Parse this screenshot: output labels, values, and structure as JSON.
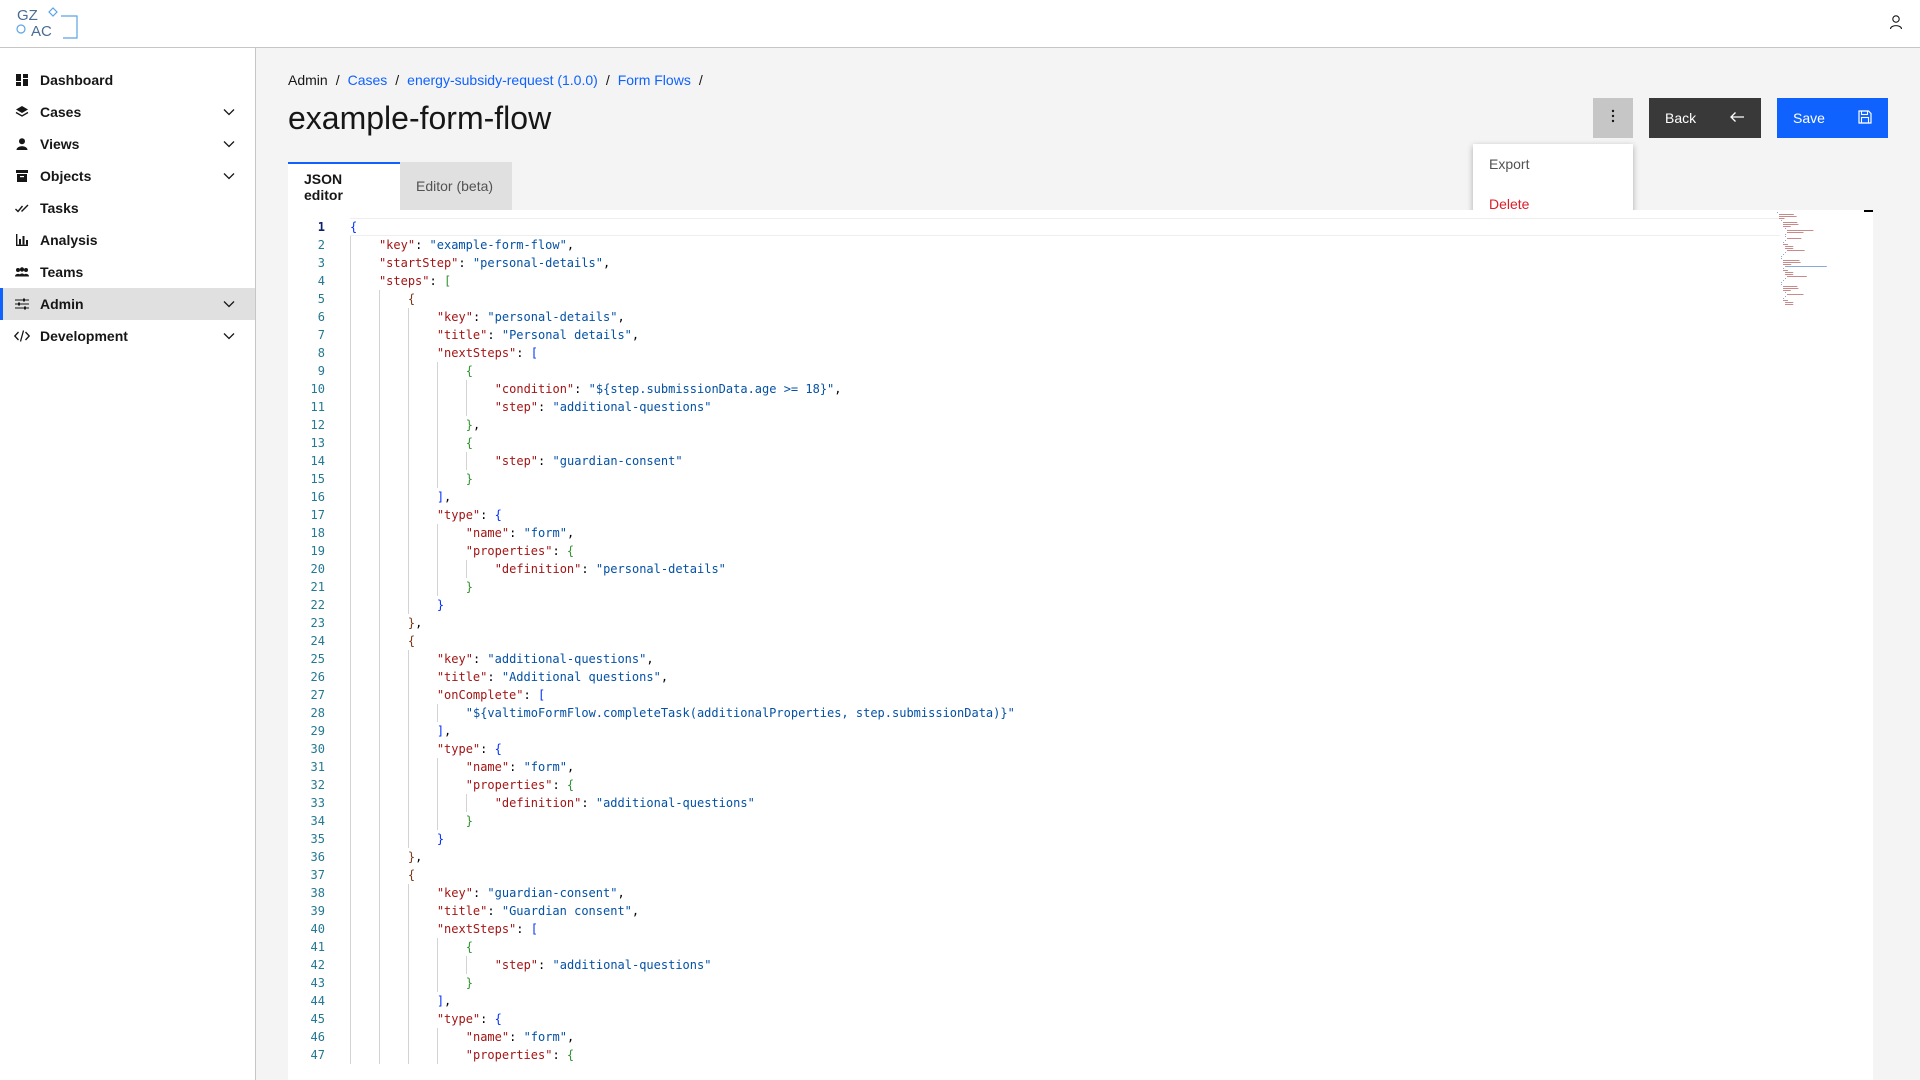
{
  "header": {
    "logo_text_top": "GZ",
    "logo_text_bottom": "AC",
    "user_icon": "user-icon"
  },
  "sidebar": {
    "items": [
      {
        "label": "Dashboard",
        "icon": "dashboard-icon",
        "has_chevron": false,
        "active": false
      },
      {
        "label": "Cases",
        "icon": "layers-icon",
        "has_chevron": true,
        "active": false
      },
      {
        "label": "Views",
        "icon": "person-icon",
        "has_chevron": true,
        "active": false
      },
      {
        "label": "Objects",
        "icon": "archive-icon",
        "has_chevron": true,
        "active": false
      },
      {
        "label": "Tasks",
        "icon": "checkmark-icon",
        "has_chevron": false,
        "active": false
      },
      {
        "label": "Analysis",
        "icon": "bar-chart-icon",
        "has_chevron": false,
        "active": false
      },
      {
        "label": "Teams",
        "icon": "group-icon",
        "has_chevron": false,
        "active": false
      },
      {
        "label": "Admin",
        "icon": "settings-adjust-icon",
        "has_chevron": true,
        "active": true
      },
      {
        "label": "Development",
        "icon": "code-icon",
        "has_chevron": true,
        "active": false
      }
    ]
  },
  "breadcrumb": {
    "items": [
      "Admin",
      "Cases",
      "energy-subsidy-request (1.0.0)",
      "Form Flows"
    ],
    "separator": "/"
  },
  "page": {
    "title": "example-form-flow"
  },
  "toolbar": {
    "overflow_icon": "overflow-menu-icon",
    "back_label": "Back",
    "save_label": "Save"
  },
  "menu": {
    "export_label": "Export",
    "delete_label": "Delete"
  },
  "tabs": {
    "json_editor": "JSON editor",
    "editor_beta": "Editor (beta)"
  },
  "colors": {
    "primary": "#0f62fe",
    "danger": "#da1e28",
    "dark_button": "#393939",
    "json_key": "#a31515",
    "json_string": "#0451a5"
  },
  "editor": {
    "current_line": 1,
    "lines": [
      "{",
      "    \"key\": \"example-form-flow\",",
      "    \"startStep\": \"personal-details\",",
      "    \"steps\": [",
      "        {",
      "            \"key\": \"personal-details\",",
      "            \"title\": \"Personal details\",",
      "            \"nextSteps\": [",
      "                {",
      "                    \"condition\": \"${step.submissionData.age >= 18}\",",
      "                    \"step\": \"additional-questions\"",
      "                },",
      "                {",
      "                    \"step\": \"guardian-consent\"",
      "                }",
      "            ],",
      "            \"type\": {",
      "                \"name\": \"form\",",
      "                \"properties\": {",
      "                    \"definition\": \"personal-details\"",
      "                }",
      "            }",
      "        },",
      "        {",
      "            \"key\": \"additional-questions\",",
      "            \"title\": \"Additional questions\",",
      "            \"onComplete\": [",
      "                \"${valtimoFormFlow.completeTask(additionalProperties, step.submissionData)}\"",
      "            ],",
      "            \"type\": {",
      "                \"name\": \"form\",",
      "                \"properties\": {",
      "                    \"definition\": \"additional-questions\"",
      "                }",
      "            }",
      "        },",
      "        {",
      "            \"key\": \"guardian-consent\",",
      "            \"title\": \"Guardian consent\",",
      "            \"nextSteps\": [",
      "                {",
      "                    \"step\": \"additional-questions\"",
      "                }",
      "            ],",
      "            \"type\": {",
      "                \"name\": \"form\",",
      "                \"properties\": {"
    ]
  }
}
